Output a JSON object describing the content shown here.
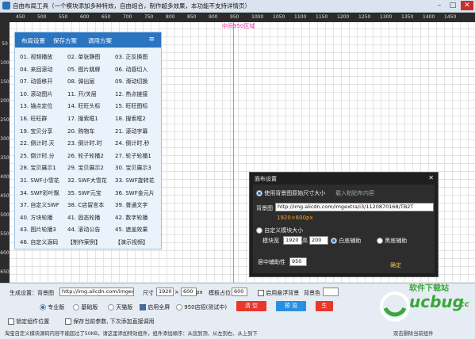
{
  "window": {
    "title": "自由布局工具（一个模块添加多种特效，自由组合，制作超多效果，本功能不支持详情页）",
    "controls": [
      "–",
      "□",
      "✕"
    ]
  },
  "ruler": {
    "top_ticks": [
      "450",
      "500",
      "550",
      "600",
      "650",
      "700",
      "750",
      "800",
      "850",
      "900",
      "950",
      "1000",
      "1050",
      "1100",
      "1150",
      "1200",
      "1250",
      "1300",
      "1350",
      "1400",
      "1450"
    ],
    "left_ticks": [
      "50",
      "100",
      "150",
      "200",
      "250",
      "300",
      "350",
      "400",
      "450",
      "500",
      "550",
      "600",
      "650"
    ]
  },
  "center_marker": "中间950区域",
  "panel": {
    "tabs": [
      "布局设置",
      "保存方案",
      "调用方案"
    ],
    "menu_icon": "≡",
    "items": [
      "01. 视频播放",
      "02. 单张静图",
      "03. 正反换图",
      "04. 来回滚动",
      "05. 图片跳牌",
      "06. 动感切入",
      "07. 动感移开",
      "08. 弹出层",
      "09. 滑动切换",
      "10. 滚动图片",
      "11. 开/关层",
      "12. 热点链接",
      "13. 锚点定位",
      "14. 旺旺头标",
      "15. 旺旺图标",
      "16. 旺旺群",
      "17. 搜索框1",
      "18. 搜索框2",
      "19. 宝贝分享",
      "20. 购物车",
      "21. 滚动字幕",
      "22. 倒计时.天",
      "23. 倒计时.时",
      "24. 倒计时.秒",
      "25. 倒计时.分",
      "26. 轮子轮播2",
      "27. 轮子轮播1",
      "28. 宝贝展示1",
      "29. 宝贝展示2",
      "30. 宝贝展示3",
      "31. SWF小雪花",
      "32. SWF大雪花",
      "33. SWF旋转花",
      "34. SWF彩叶飘",
      "35. SWF元宝",
      "36. SWF金元片",
      "37. 自定义SWF",
      "38. C店留言本",
      "39. 普通文字",
      "40. 方块轮播",
      "41. 固态轮播",
      "42. 数字轮播",
      "43. 图片轮播3",
      "44. 滚动公告",
      "45. 遮盖效果",
      "46. 自定义源码",
      "【制作案例】",
      "【演示视频】"
    ]
  },
  "dialog": {
    "title": "面布设置",
    "close": "✕",
    "option_bg_size": "使用背景图原始尺寸大小",
    "import_link": "载入粘贴布内容",
    "bg_label": "背景图",
    "bg_url": "http://img.alicdn.com/imgextra/i3/1120870168/TB2T",
    "bg_size_hint": "1920×600px",
    "option_custom": "自定义模块大小",
    "width_label": "模块宽",
    "width_value": "1920",
    "height_label": "高",
    "height_value": "200",
    "assist_white": "白底辅助",
    "assist_black": "黑底辅助",
    "center_width_label": "居中辅助性",
    "center_width_value": "950",
    "confirm": "确定"
  },
  "bottom": {
    "gen_label": "生成设置：背景图",
    "bg_url": "http://img.alicdn.com/imgext",
    "size_label": "尺寸",
    "size_w": "1920",
    "size_x": "×",
    "size_h": "600",
    "size_unit": "px",
    "template_label": "模板占位",
    "template_value": "600",
    "enable_bg": "启用悬浮背景",
    "bg_color_label": "背景色",
    "mode_pro": "专业版",
    "mode_basic": "基础版",
    "mode_tmall": "天猫版",
    "fullscreen": "启用全屏",
    "shop950": "950店招(测试中)",
    "clear_button": "清 空",
    "preview_button": "预 览",
    "generate_button": "生",
    "lock_label": "锁定组件位置",
    "save_label": "保存当前参数, 下次添加直接调用",
    "status_text": "淘宝自定义模块源码内容不能超过了50KB，请这里添加特效组件，组件添加顺序：从底到顶、从左到右、从上到下",
    "status_right": "双击删除当前组件"
  },
  "watermark": {
    "line1": "软件下载站",
    "brand": "ucbug",
    "suffix": ".cc"
  },
  "colors": {
    "accent": "#2a74c0",
    "clear": "#e8372b",
    "preview": "#2a8fe0",
    "generate": "#e8372b",
    "center_line": "#ff33aa",
    "watermark": "#3aa83a"
  }
}
